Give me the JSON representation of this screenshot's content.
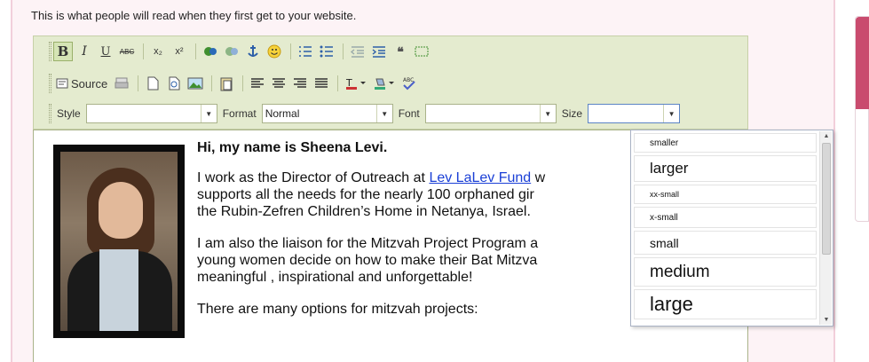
{
  "intro_text": "This is what people will read when they first get to your website.",
  "toolbar": {
    "row1": {
      "bold": "B",
      "italic": "I",
      "underline": "U",
      "strike": "ABC",
      "subscript": "x₂",
      "superscript": "x²"
    },
    "row2": {
      "source_label": "Source"
    },
    "row3": {
      "style_label": "Style",
      "style_value": "",
      "format_label": "Format",
      "format_value": "Normal",
      "font_label": "Font",
      "font_value": "",
      "size_label": "Size",
      "size_value": ""
    }
  },
  "content": {
    "heading": "Hi, my name is Sheena Levi.",
    "p1_before": "I work as the Director of Outreach at ",
    "p1_link": "Lev LaLev Fund",
    "p1_after": " w",
    "p1_line2": "supports all the needs for the nearly 100 orphaned gir",
    "p1_line3": "the Rubin-Zefren Children’s  Home in Netanya, Israel.",
    "p2_line1": "I am also the liaison for the Mitzvah Project Program a",
    "p2_line2": "young women decide on how to make their Bat Mitzva",
    "p2_line3": "meaningful , inspirational and unforgettable!",
    "p3": "There are many options for mitzvah projects:"
  },
  "size_dropdown": {
    "options": [
      "smaller",
      "larger",
      "xx-small",
      "x-small",
      "small",
      "medium",
      "large"
    ]
  },
  "colors": {
    "toolbar_bg": "#e4ebcf",
    "link": "#1a3fd6",
    "side_accent": "#c94b6e"
  }
}
